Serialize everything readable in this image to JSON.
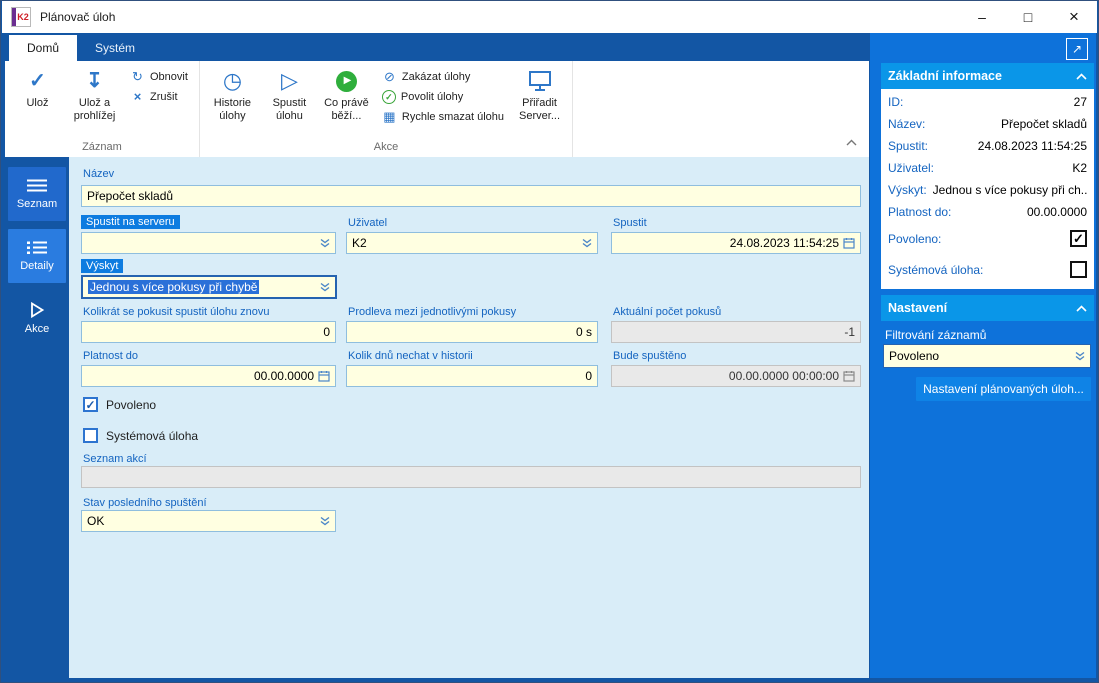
{
  "window": {
    "title": "Plánovač úloh",
    "logo": "K2"
  },
  "titlebar": {
    "minimize": "–",
    "maximize": "□",
    "close": "×"
  },
  "tabs": [
    {
      "label": "Domů"
    },
    {
      "label": "Systém"
    }
  ],
  "ribbon": {
    "groups": [
      {
        "name": "Záznam",
        "buttons": [
          {
            "label": "Ulož"
          },
          {
            "label": "Ulož a prohlížej"
          },
          {
            "label": "Obnovit"
          },
          {
            "label": "Zrušit"
          }
        ]
      },
      {
        "name": "Akce",
        "buttons": [
          {
            "label": "Historie úlohy"
          },
          {
            "label": "Spustit úlohu"
          },
          {
            "label": "Co právě běží..."
          },
          {
            "label": "Zakázat úlohy"
          },
          {
            "label": "Povolit úlohy"
          },
          {
            "label": "Rychle smazat úlohu"
          },
          {
            "label": "Přiřadit Server..."
          }
        ]
      }
    ]
  },
  "sidebar": {
    "items": [
      {
        "label": "Seznam"
      },
      {
        "label": "Detaily"
      },
      {
        "label": "Akce"
      }
    ]
  },
  "form": {
    "nazev": {
      "label": "Název",
      "value": "Přepočet skladů"
    },
    "spustit_na_serveru": {
      "label": "Spustit na serveru",
      "value": ""
    },
    "uzivatel": {
      "label": "Uživatel",
      "value": "K2"
    },
    "spustit": {
      "label": "Spustit",
      "value": "24.08.2023 11:54:25"
    },
    "vyskyt": {
      "label": "Výskyt",
      "value": "Jednou s více pokusy při chybě"
    },
    "pokusy_znovu": {
      "label": "Kolikrát se pokusit spustit úlohu znovu",
      "value": "0"
    },
    "prodleva": {
      "label": "Prodleva mezi jednotlivými pokusy",
      "value": "0 s"
    },
    "aktualni_pokusy": {
      "label": "Aktuální počet pokusů",
      "value": "-1"
    },
    "platnost_do": {
      "label": "Platnost do",
      "value": "00.00.0000"
    },
    "kolik_dnu": {
      "label": "Kolik dnů nechat v historii",
      "value": "0"
    },
    "bude_spusteno": {
      "label": "Bude spuštěno",
      "value": "00.00.0000 00:00:00"
    },
    "povoleno": {
      "label": "Povoleno",
      "checked": true
    },
    "systemova_uloha": {
      "label": "Systémová úloha",
      "checked": false
    },
    "seznam_akci": {
      "label": "Seznam akcí",
      "value": ""
    },
    "stav_posledniho_spusteni": {
      "label": "Stav posledního spuštění",
      "value": "OK"
    }
  },
  "info_panel": {
    "title": "Základní informace",
    "rows": [
      {
        "label": "ID:",
        "value": "27"
      },
      {
        "label": "Název:",
        "value": "Přepočet skladů"
      },
      {
        "label": "Spustit:",
        "value": "24.08.2023 11:54:25"
      },
      {
        "label": "Uživatel:",
        "value": "K2"
      },
      {
        "label": "Výskyt:",
        "value": "Jednou s více pokusy při ch..."
      },
      {
        "label": "Platnost do:",
        "value": "00.00.0000"
      }
    ],
    "check_rows": [
      {
        "label": "Povoleno:",
        "checked": true
      },
      {
        "label": "Systémová úloha:",
        "checked": false
      }
    ]
  },
  "settings_panel": {
    "title": "Nastavení",
    "filter_label": "Filtrování záznamů",
    "filter_value": "Povoleno",
    "settings_button_label": "Nastavení plánovaných úloh..."
  },
  "icons": {
    "check": "✓",
    "save": "✓",
    "save_browse": "↧",
    "refresh": "↻",
    "cancel": "×",
    "history": "◷",
    "run": "▷",
    "running": "▶",
    "disable": "⊘",
    "enable": "✓",
    "quick_delete": "▦",
    "expand": "↗"
  },
  "colors": {
    "frame_blue": "#1356a4",
    "panel_blue": "#0e72da",
    "section_header_blue": "#0a96e8",
    "field_yellow": "#ffffe1",
    "form_background": "#d9edf8",
    "label_blue": "#1464c0",
    "selection_blue": "#2a70d8",
    "accent_green": "#2fae3c"
  }
}
